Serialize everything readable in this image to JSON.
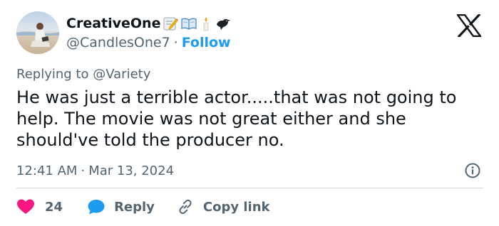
{
  "author": {
    "display_name": "CreativeOne",
    "name_emojis": [
      "memo-icon",
      "open-book-icon",
      "candle-icon",
      "black-bird-icon"
    ],
    "handle": "@CandlesOne7",
    "separator": "·",
    "follow_label": "Follow"
  },
  "reply_context": {
    "prefix": "Replying to",
    "mention": "@Variety"
  },
  "tweet": {
    "text": "He was just a terrible actor.....that was not going to help. The movie was not great either and she should've told the producer no.",
    "time": "12:41 AM",
    "separator": "·",
    "date": "Mar 13, 2024"
  },
  "actions": {
    "like_count": "24",
    "reply_label": "Reply",
    "copy_label": "Copy link"
  },
  "colors": {
    "text": "#0f1419",
    "secondary": "#536471",
    "link": "#1d9bf0",
    "like": "#f91880",
    "divider": "#cfd9de"
  }
}
